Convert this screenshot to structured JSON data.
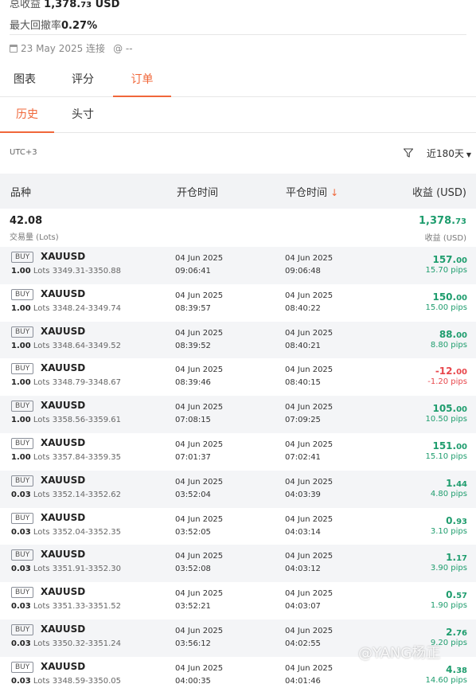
{
  "account": {
    "total_profit_label": "总收益",
    "total_profit_main": "1,378.",
    "total_profit_small": "73",
    "total_profit_currency": "USD",
    "max_drawdown_label": "最大回撤率",
    "max_drawdown_value": "0.27%",
    "connected": "23 May 2025 连接",
    "at_text": "@ --"
  },
  "tabs": [
    "图表",
    "评分",
    "订单"
  ],
  "active_tab": "订单",
  "subtabs": [
    "历史",
    "头寸"
  ],
  "active_subtab": "历史",
  "filter": {
    "timezone": "UTC+3",
    "period": "近180天",
    "filter_icon": "filter-funnel-icon",
    "period_icon": "caret-down-icon"
  },
  "table": {
    "headers": {
      "symbol": "品种",
      "open_time": "开仓时间",
      "close_time": "平仓时间",
      "profit": "收益 (USD)"
    },
    "sort_icon": "sort-arrow-down-icon",
    "summary": {
      "volume": "42.08",
      "volume_label": "交易量 (Lots)",
      "profit_main": "1,378.",
      "profit_small": "73",
      "profit_label": "收益 (USD)"
    },
    "rows": [
      {
        "side": "BUY",
        "symbol": "XAUUSD",
        "lots": "1.00",
        "lots_unit": "Lots",
        "range": "3349.31-3350.88",
        "open_date": "04 Jun 2025",
        "open_time": "09:06:41",
        "close_date": "04 Jun 2025",
        "close_time": "09:06:48",
        "profit_main": "157.",
        "profit_small": "00",
        "pips": "15.70 pips",
        "sign": "pos"
      },
      {
        "side": "BUY",
        "symbol": "XAUUSD",
        "lots": "1.00",
        "lots_unit": "Lots",
        "range": "3348.24-3349.74",
        "open_date": "04 Jun 2025",
        "open_time": "08:39:57",
        "close_date": "04 Jun 2025",
        "close_time": "08:40:22",
        "profit_main": "150.",
        "profit_small": "00",
        "pips": "15.00 pips",
        "sign": "pos"
      },
      {
        "side": "BUY",
        "symbol": "XAUUSD",
        "lots": "1.00",
        "lots_unit": "Lots",
        "range": "3348.64-3349.52",
        "open_date": "04 Jun 2025",
        "open_time": "08:39:52",
        "close_date": "04 Jun 2025",
        "close_time": "08:40:21",
        "profit_main": "88.",
        "profit_small": "00",
        "pips": "8.80 pips",
        "sign": "pos"
      },
      {
        "side": "BUY",
        "symbol": "XAUUSD",
        "lots": "1.00",
        "lots_unit": "Lots",
        "range": "3348.79-3348.67",
        "open_date": "04 Jun 2025",
        "open_time": "08:39:46",
        "close_date": "04 Jun 2025",
        "close_time": "08:40:15",
        "profit_main": "-12.",
        "profit_small": "00",
        "pips": "-1.20 pips",
        "sign": "neg"
      },
      {
        "side": "BUY",
        "symbol": "XAUUSD",
        "lots": "1.00",
        "lots_unit": "Lots",
        "range": "3358.56-3359.61",
        "open_date": "04 Jun 2025",
        "open_time": "07:08:15",
        "close_date": "04 Jun 2025",
        "close_time": "07:09:25",
        "profit_main": "105.",
        "profit_small": "00",
        "pips": "10.50 pips",
        "sign": "pos"
      },
      {
        "side": "BUY",
        "symbol": "XAUUSD",
        "lots": "1.00",
        "lots_unit": "Lots",
        "range": "3357.84-3359.35",
        "open_date": "04 Jun 2025",
        "open_time": "07:01:37",
        "close_date": "04 Jun 2025",
        "close_time": "07:02:41",
        "profit_main": "151.",
        "profit_small": "00",
        "pips": "15.10 pips",
        "sign": "pos"
      },
      {
        "side": "BUY",
        "symbol": "XAUUSD",
        "lots": "0.03",
        "lots_unit": "Lots",
        "range": "3352.14-3352.62",
        "open_date": "04 Jun 2025",
        "open_time": "03:52:04",
        "close_date": "04 Jun 2025",
        "close_time": "04:03:39",
        "profit_main": "1.",
        "profit_small": "44",
        "pips": "4.80 pips",
        "sign": "pos"
      },
      {
        "side": "BUY",
        "symbol": "XAUUSD",
        "lots": "0.03",
        "lots_unit": "Lots",
        "range": "3352.04-3352.35",
        "open_date": "04 Jun 2025",
        "open_time": "03:52:05",
        "close_date": "04 Jun 2025",
        "close_time": "04:03:14",
        "profit_main": "0.",
        "profit_small": "93",
        "pips": "3.10 pips",
        "sign": "pos"
      },
      {
        "side": "BUY",
        "symbol": "XAUUSD",
        "lots": "0.03",
        "lots_unit": "Lots",
        "range": "3351.91-3352.30",
        "open_date": "04 Jun 2025",
        "open_time": "03:52:08",
        "close_date": "04 Jun 2025",
        "close_time": "04:03:12",
        "profit_main": "1.",
        "profit_small": "17",
        "pips": "3.90 pips",
        "sign": "pos"
      },
      {
        "side": "BUY",
        "symbol": "XAUUSD",
        "lots": "0.03",
        "lots_unit": "Lots",
        "range": "3351.33-3351.52",
        "open_date": "04 Jun 2025",
        "open_time": "03:52:21",
        "close_date": "04 Jun 2025",
        "close_time": "04:03:07",
        "profit_main": "0.",
        "profit_small": "57",
        "pips": "1.90 pips",
        "sign": "pos"
      },
      {
        "side": "BUY",
        "symbol": "XAUUSD",
        "lots": "0.03",
        "lots_unit": "Lots",
        "range": "3350.32-3351.24",
        "open_date": "04 Jun 2025",
        "open_time": "03:56:12",
        "close_date": "04 Jun 2025",
        "close_time": "04:02:55",
        "profit_main": "2.",
        "profit_small": "76",
        "pips": "9.20 pips",
        "sign": "pos"
      },
      {
        "side": "BUY",
        "symbol": "XAUUSD",
        "lots": "0.03",
        "lots_unit": "Lots",
        "range": "3348.59-3350.05",
        "open_date": "04 Jun 2025",
        "open_time": "04:00:35",
        "close_date": "04 Jun 2025",
        "close_time": "04:01:46",
        "profit_main": "4.",
        "profit_small": "38",
        "pips": "14.60 pips",
        "sign": "pos"
      }
    ]
  },
  "watermark": "@YANG杨正",
  "colors": {
    "accent": "#f0673a",
    "positive": "#1f9d6e",
    "negative": "#e8474c",
    "header_bg": "#f2f3f5"
  }
}
